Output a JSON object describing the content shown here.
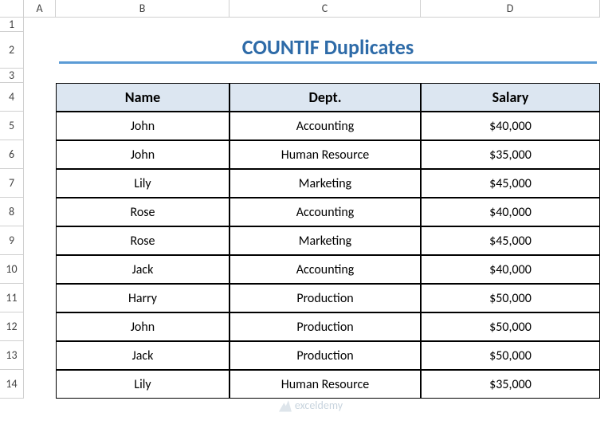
{
  "columns": [
    "A",
    "B",
    "C",
    "D"
  ],
  "rows": [
    "1",
    "2",
    "3",
    "4",
    "5",
    "6",
    "7",
    "8",
    "9",
    "10",
    "11",
    "12",
    "13",
    "14"
  ],
  "title": "COUNTIF Duplicates",
  "headers": {
    "name": "Name",
    "dept": "Dept.",
    "salary": "Salary"
  },
  "data": [
    {
      "name": "John",
      "dept": "Accounting",
      "salary": "$40,000"
    },
    {
      "name": "John",
      "dept": "Human Resource",
      "salary": "$35,000"
    },
    {
      "name": "Lily",
      "dept": "Marketing",
      "salary": "$45,000"
    },
    {
      "name": "Rose",
      "dept": "Accounting",
      "salary": "$40,000"
    },
    {
      "name": "Rose",
      "dept": "Marketing",
      "salary": "$45,000"
    },
    {
      "name": "Jack",
      "dept": "Accounting",
      "salary": "$40,000"
    },
    {
      "name": "Harry",
      "dept": "Production",
      "salary": "$50,000"
    },
    {
      "name": "John",
      "dept": "Production",
      "salary": "$50,000"
    },
    {
      "name": "Jack",
      "dept": "Production",
      "salary": "$50,000"
    },
    {
      "name": "Lily",
      "dept": "Human Resource",
      "salary": "$35,000"
    }
  ],
  "watermark": "exceldemy",
  "chart_data": {
    "type": "table",
    "title": "COUNTIF Duplicates",
    "columns": [
      "Name",
      "Dept.",
      "Salary"
    ],
    "rows": [
      [
        "John",
        "Accounting",
        40000
      ],
      [
        "John",
        "Human Resource",
        35000
      ],
      [
        "Lily",
        "Marketing",
        45000
      ],
      [
        "Rose",
        "Accounting",
        40000
      ],
      [
        "Rose",
        "Marketing",
        45000
      ],
      [
        "Jack",
        "Accounting",
        40000
      ],
      [
        "Harry",
        "Production",
        50000
      ],
      [
        "John",
        "Production",
        50000
      ],
      [
        "Jack",
        "Production",
        50000
      ],
      [
        "Lily",
        "Human Resource",
        35000
      ]
    ]
  }
}
